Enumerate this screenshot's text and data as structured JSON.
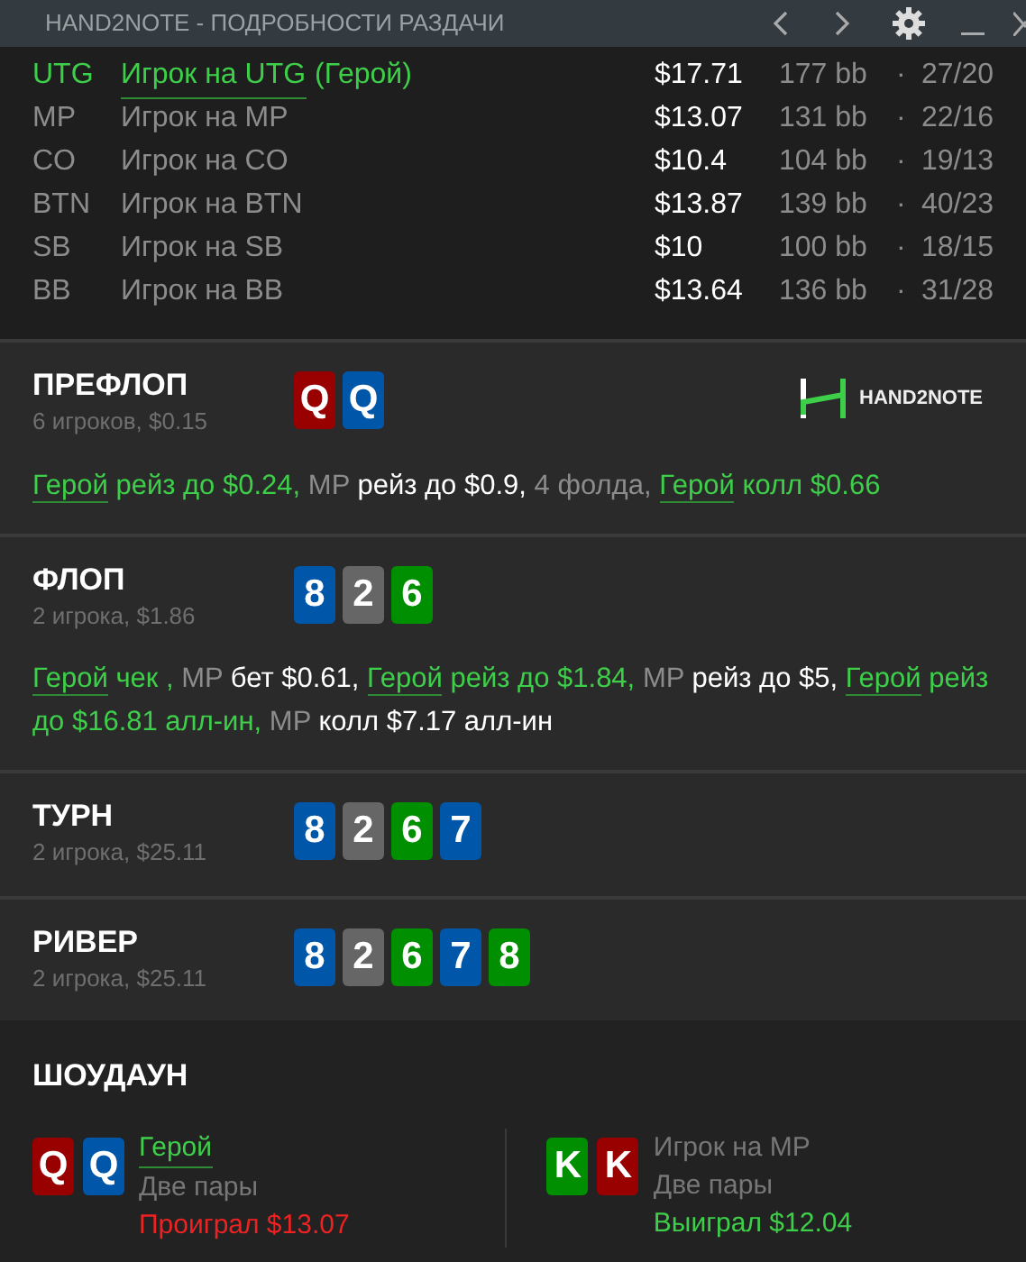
{
  "window": {
    "title": "HAND2NOTE - ПОДРОБНОСТИ РАЗДАЧИ"
  },
  "players": [
    {
      "position": "UTG",
      "name": "Игрок на UTG",
      "hero": true,
      "hero_tag": "(Герой)",
      "stack": "$17.71",
      "bb": "177 bb",
      "separator": "·",
      "stats": "27/20"
    },
    {
      "position": "MP",
      "name": "Игрок на MP",
      "hero": false,
      "stack": "$13.07",
      "bb": "131 bb",
      "separator": "·",
      "stats": "22/16"
    },
    {
      "position": "CO",
      "name": "Игрок на CO",
      "hero": false,
      "stack": "$10.4",
      "bb": "104 bb",
      "separator": "·",
      "stats": "19/13"
    },
    {
      "position": "BTN",
      "name": "Игрок на BTN",
      "hero": false,
      "stack": "$13.87",
      "bb": "139 bb",
      "separator": "·",
      "stats": "40/23"
    },
    {
      "position": "SB",
      "name": "Игрок на SB",
      "hero": false,
      "stack": "$10",
      "bb": "100 bb",
      "separator": "·",
      "stats": "18/15"
    },
    {
      "position": "BB",
      "name": "Игрок на BB",
      "hero": false,
      "stack": "$13.64",
      "bb": "136 bb",
      "separator": "·",
      "stats": "31/28"
    }
  ],
  "streets": [
    {
      "name": "ПРЕФЛОП",
      "info": "6 игроков, $0.15",
      "logo": "HAND2NOTE",
      "cards": [
        {
          "rank": "Q",
          "color": "#990000"
        },
        {
          "rank": "Q",
          "color": "#0056a8"
        }
      ],
      "actions": [
        {
          "kind": "hero",
          "text": "Герой"
        },
        {
          "kind": "hero_action",
          "text": "рейз до $0.24,"
        },
        {
          "kind": "player",
          "text": "MP"
        },
        {
          "kind": "action",
          "text": "рейз до $0.9,"
        },
        {
          "kind": "player",
          "text": "4 фолда,"
        },
        {
          "kind": "hero",
          "text": "Герой"
        },
        {
          "kind": "hero_action",
          "text": "колл $0.66"
        }
      ]
    },
    {
      "name": "ФЛОП",
      "info": "2 игрока, $1.86",
      "cards": [
        {
          "rank": "8",
          "color": "#0056a8"
        },
        {
          "rank": "2",
          "color": "#666666"
        },
        {
          "rank": "6",
          "color": "#008f00"
        }
      ],
      "actions": [
        {
          "kind": "hero",
          "text": "Герой"
        },
        {
          "kind": "hero_action",
          "text": "чек ,"
        },
        {
          "kind": "player",
          "text": "MP"
        },
        {
          "kind": "action",
          "text": "бет $0.61,"
        },
        {
          "kind": "hero",
          "text": "Герой"
        },
        {
          "kind": "hero_action",
          "text": "рейз до $1.84,"
        },
        {
          "kind": "player",
          "text": "MP"
        },
        {
          "kind": "action",
          "text": "рейз до $5,"
        },
        {
          "kind": "hero",
          "text": "Герой"
        },
        {
          "kind": "hero_action",
          "text": "рейз до $16.81 алл-ин,"
        },
        {
          "kind": "player",
          "text": "MP"
        },
        {
          "kind": "action",
          "text": "колл $7.17 алл-ин"
        }
      ]
    },
    {
      "name": "ТУРН",
      "info": "2 игрока, $25.11",
      "cards": [
        {
          "rank": "8",
          "color": "#0056a8"
        },
        {
          "rank": "2",
          "color": "#666666"
        },
        {
          "rank": "6",
          "color": "#008f00"
        },
        {
          "rank": "7",
          "color": "#0056a8"
        }
      ]
    },
    {
      "name": "РИВЕР",
      "info": "2 игрока, $25.11",
      "cards": [
        {
          "rank": "8",
          "color": "#0056a8"
        },
        {
          "rank": "2",
          "color": "#666666"
        },
        {
          "rank": "6",
          "color": "#008f00"
        },
        {
          "rank": "7",
          "color": "#0056a8"
        },
        {
          "rank": "8",
          "color": "#008f00"
        }
      ]
    }
  ],
  "showdown": {
    "title": "ШОУДАУН",
    "hands": [
      {
        "name": "Герой",
        "hero": true,
        "hand": "Две пары",
        "result": "Проиграл $13.07",
        "won": false,
        "cards": [
          {
            "rank": "Q",
            "color": "#990000"
          },
          {
            "rank": "Q",
            "color": "#0056a8"
          }
        ]
      },
      {
        "name": "Игрок на MP",
        "hero": false,
        "hand": "Две пары",
        "result": "Выиграл $12.04",
        "won": true,
        "cards": [
          {
            "rank": "K",
            "color": "#008f00"
          },
          {
            "rank": "K",
            "color": "#990000"
          }
        ]
      }
    ]
  }
}
